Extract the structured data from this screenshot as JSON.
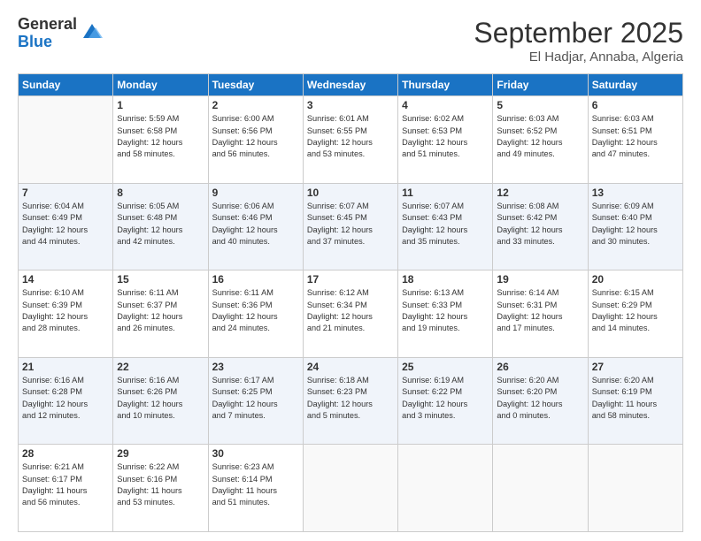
{
  "logo": {
    "general": "General",
    "blue": "Blue"
  },
  "header": {
    "title": "September 2025",
    "subtitle": "El Hadjar, Annaba, Algeria"
  },
  "days": [
    "Sunday",
    "Monday",
    "Tuesday",
    "Wednesday",
    "Thursday",
    "Friday",
    "Saturday"
  ],
  "weeks": [
    [
      {
        "day": "",
        "content": ""
      },
      {
        "day": "1",
        "content": "Sunrise: 5:59 AM\nSunset: 6:58 PM\nDaylight: 12 hours\nand 58 minutes."
      },
      {
        "day": "2",
        "content": "Sunrise: 6:00 AM\nSunset: 6:56 PM\nDaylight: 12 hours\nand 56 minutes."
      },
      {
        "day": "3",
        "content": "Sunrise: 6:01 AM\nSunset: 6:55 PM\nDaylight: 12 hours\nand 53 minutes."
      },
      {
        "day": "4",
        "content": "Sunrise: 6:02 AM\nSunset: 6:53 PM\nDaylight: 12 hours\nand 51 minutes."
      },
      {
        "day": "5",
        "content": "Sunrise: 6:03 AM\nSunset: 6:52 PM\nDaylight: 12 hours\nand 49 minutes."
      },
      {
        "day": "6",
        "content": "Sunrise: 6:03 AM\nSunset: 6:51 PM\nDaylight: 12 hours\nand 47 minutes."
      }
    ],
    [
      {
        "day": "7",
        "content": "Sunrise: 6:04 AM\nSunset: 6:49 PM\nDaylight: 12 hours\nand 44 minutes."
      },
      {
        "day": "8",
        "content": "Sunrise: 6:05 AM\nSunset: 6:48 PM\nDaylight: 12 hours\nand 42 minutes."
      },
      {
        "day": "9",
        "content": "Sunrise: 6:06 AM\nSunset: 6:46 PM\nDaylight: 12 hours\nand 40 minutes."
      },
      {
        "day": "10",
        "content": "Sunrise: 6:07 AM\nSunset: 6:45 PM\nDaylight: 12 hours\nand 37 minutes."
      },
      {
        "day": "11",
        "content": "Sunrise: 6:07 AM\nSunset: 6:43 PM\nDaylight: 12 hours\nand 35 minutes."
      },
      {
        "day": "12",
        "content": "Sunrise: 6:08 AM\nSunset: 6:42 PM\nDaylight: 12 hours\nand 33 minutes."
      },
      {
        "day": "13",
        "content": "Sunrise: 6:09 AM\nSunset: 6:40 PM\nDaylight: 12 hours\nand 30 minutes."
      }
    ],
    [
      {
        "day": "14",
        "content": "Sunrise: 6:10 AM\nSunset: 6:39 PM\nDaylight: 12 hours\nand 28 minutes."
      },
      {
        "day": "15",
        "content": "Sunrise: 6:11 AM\nSunset: 6:37 PM\nDaylight: 12 hours\nand 26 minutes."
      },
      {
        "day": "16",
        "content": "Sunrise: 6:11 AM\nSunset: 6:36 PM\nDaylight: 12 hours\nand 24 minutes."
      },
      {
        "day": "17",
        "content": "Sunrise: 6:12 AM\nSunset: 6:34 PM\nDaylight: 12 hours\nand 21 minutes."
      },
      {
        "day": "18",
        "content": "Sunrise: 6:13 AM\nSunset: 6:33 PM\nDaylight: 12 hours\nand 19 minutes."
      },
      {
        "day": "19",
        "content": "Sunrise: 6:14 AM\nSunset: 6:31 PM\nDaylight: 12 hours\nand 17 minutes."
      },
      {
        "day": "20",
        "content": "Sunrise: 6:15 AM\nSunset: 6:29 PM\nDaylight: 12 hours\nand 14 minutes."
      }
    ],
    [
      {
        "day": "21",
        "content": "Sunrise: 6:16 AM\nSunset: 6:28 PM\nDaylight: 12 hours\nand 12 minutes."
      },
      {
        "day": "22",
        "content": "Sunrise: 6:16 AM\nSunset: 6:26 PM\nDaylight: 12 hours\nand 10 minutes."
      },
      {
        "day": "23",
        "content": "Sunrise: 6:17 AM\nSunset: 6:25 PM\nDaylight: 12 hours\nand 7 minutes."
      },
      {
        "day": "24",
        "content": "Sunrise: 6:18 AM\nSunset: 6:23 PM\nDaylight: 12 hours\nand 5 minutes."
      },
      {
        "day": "25",
        "content": "Sunrise: 6:19 AM\nSunset: 6:22 PM\nDaylight: 12 hours\nand 3 minutes."
      },
      {
        "day": "26",
        "content": "Sunrise: 6:20 AM\nSunset: 6:20 PM\nDaylight: 12 hours\nand 0 minutes."
      },
      {
        "day": "27",
        "content": "Sunrise: 6:20 AM\nSunset: 6:19 PM\nDaylight: 11 hours\nand 58 minutes."
      }
    ],
    [
      {
        "day": "28",
        "content": "Sunrise: 6:21 AM\nSunset: 6:17 PM\nDaylight: 11 hours\nand 56 minutes."
      },
      {
        "day": "29",
        "content": "Sunrise: 6:22 AM\nSunset: 6:16 PM\nDaylight: 11 hours\nand 53 minutes."
      },
      {
        "day": "30",
        "content": "Sunrise: 6:23 AM\nSunset: 6:14 PM\nDaylight: 11 hours\nand 51 minutes."
      },
      {
        "day": "",
        "content": ""
      },
      {
        "day": "",
        "content": ""
      },
      {
        "day": "",
        "content": ""
      },
      {
        "day": "",
        "content": ""
      }
    ]
  ]
}
